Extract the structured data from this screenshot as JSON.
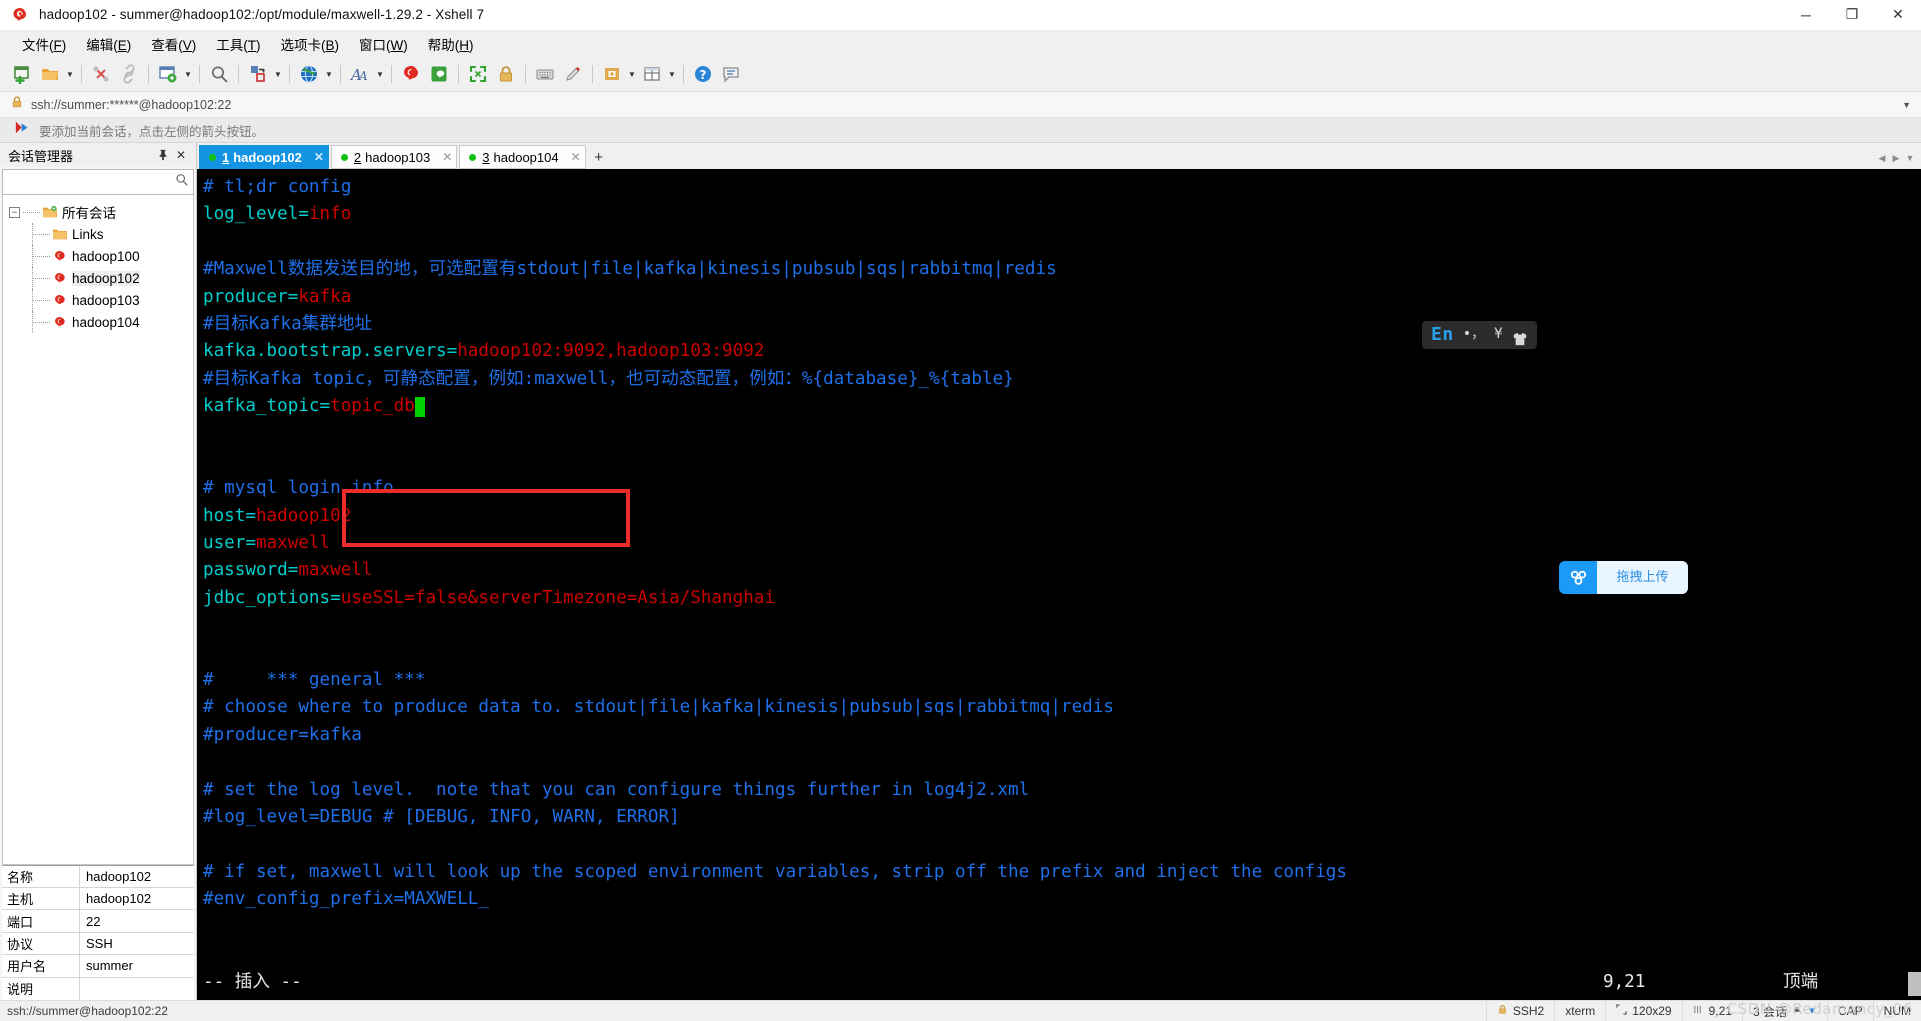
{
  "window": {
    "title": "hadoop102 - summer@hadoop102:/opt/module/maxwell-1.29.2 - Xshell 7",
    "minimize": "─",
    "maximize": "❐",
    "close": "✕"
  },
  "menu": {
    "items": [
      {
        "label": "文件",
        "accel": "F"
      },
      {
        "label": "编辑",
        "accel": "E"
      },
      {
        "label": "查看",
        "accel": "V"
      },
      {
        "label": "工具",
        "accel": "T"
      },
      {
        "label": "选项卡",
        "accel": "B"
      },
      {
        "label": "窗口",
        "accel": "W"
      },
      {
        "label": "帮助",
        "accel": "H"
      }
    ]
  },
  "toolbar": {
    "icons": [
      "new-session-icon",
      "open-folder-icon",
      "connect-icon",
      "disconnect-icon",
      "session-properties-icon",
      "find-icon",
      "transfer-file-icon",
      "web-browser-icon",
      "font-icon",
      "xshell-icon",
      "xftp-icon",
      "fullscreen-icon",
      "lock-icon",
      "keyboard-icon",
      "highlight-icon",
      "add-note-icon",
      "layout-icon",
      "help-icon",
      "feedback-icon"
    ]
  },
  "address": {
    "lock_icon": "lock-icon",
    "url": "ssh://summer:******@hadoop102:22",
    "dropdown_icon": "chevron-down-icon"
  },
  "notice": {
    "icon": "red-arrow-icon",
    "text": "要添加当前会话，点击左侧的箭头按钮。"
  },
  "sidebar": {
    "title": "会话管理器",
    "pin_icon": "pin-icon",
    "close_icon": "close-icon",
    "search": {
      "value": "",
      "placeholder": "",
      "icon": "search-icon"
    },
    "tree": {
      "root": {
        "label": "所有会话",
        "icon": "folder-sessions-icon",
        "expander": "−"
      },
      "children": [
        {
          "label": "Links",
          "icon": "folder-icon",
          "selected": false
        },
        {
          "label": "hadoop100",
          "icon": "xshell-session-icon",
          "selected": false
        },
        {
          "label": "hadoop102",
          "icon": "xshell-session-icon",
          "selected": true
        },
        {
          "label": "hadoop103",
          "icon": "xshell-session-icon",
          "selected": false
        },
        {
          "label": "hadoop104",
          "icon": "xshell-session-icon",
          "selected": false
        }
      ]
    },
    "properties": [
      {
        "key": "名称",
        "value": "hadoop102"
      },
      {
        "key": "主机",
        "value": "hadoop102"
      },
      {
        "key": "端口",
        "value": "22"
      },
      {
        "key": "协议",
        "value": "SSH"
      },
      {
        "key": "用户名",
        "value": "summer"
      },
      {
        "key": "说明",
        "value": ""
      }
    ]
  },
  "tabs": {
    "items": [
      {
        "num": "1",
        "label": "hadoop102",
        "active": true,
        "close": "✕",
        "status": "connected"
      },
      {
        "num": "2",
        "label": "hadoop103",
        "active": false,
        "close": "✕",
        "status": "connected"
      },
      {
        "num": "3",
        "label": "hadoop104",
        "active": false,
        "close": "✕",
        "status": "connected"
      }
    ],
    "add_label": "+",
    "nav_left": "◀",
    "nav_right": "▶",
    "nav_down": "▼"
  },
  "ime": {
    "lang": "En",
    "punct": "•，",
    "currency": "¥",
    "skin_icon": "shirt-icon"
  },
  "upload": {
    "icon": "cloud-upload-icon",
    "label": "拖拽上传"
  },
  "annotation": {
    "type": "red-rectangle-highlight",
    "color": "#ee2b2b"
  },
  "terminal": {
    "colors": {
      "background": "#000000",
      "comment": "#1e6fe8",
      "key": "#00cdcd",
      "value": "#cc0000",
      "text": "#e8e8e8",
      "cursor": "#00d000"
    },
    "lines": [
      {
        "segs": [
          {
            "t": "# tl;dr config",
            "c": "comment"
          }
        ]
      },
      {
        "segs": [
          {
            "t": "log_level",
            "c": "key"
          },
          {
            "t": "=",
            "c": "key"
          },
          {
            "t": "info",
            "c": "value"
          }
        ]
      },
      {
        "segs": []
      },
      {
        "segs": [
          {
            "t": "#Maxwell数据发送目的地，可选配置有stdout|file|kafka|kinesis|pubsub|sqs|rabbitmq|redis",
            "c": "comment"
          }
        ]
      },
      {
        "segs": [
          {
            "t": "producer",
            "c": "key"
          },
          {
            "t": "=",
            "c": "key"
          },
          {
            "t": "kafka",
            "c": "value"
          }
        ]
      },
      {
        "segs": [
          {
            "t": "#目标Kafka集群地址",
            "c": "comment"
          }
        ]
      },
      {
        "segs": [
          {
            "t": "kafka.bootstrap.servers",
            "c": "key"
          },
          {
            "t": "=",
            "c": "key"
          },
          {
            "t": "hadoop102:9092,hadoop103:9092",
            "c": "value"
          }
        ]
      },
      {
        "segs": [
          {
            "t": "#目标Kafka topic，可静态配置，例如:maxwell，也可动态配置，例如：%{database}_%{table}",
            "c": "comment"
          }
        ]
      },
      {
        "segs": [
          {
            "t": "kafka_topic",
            "c": "key"
          },
          {
            "t": "=",
            "c": "key"
          },
          {
            "t": "topic_db",
            "c": "value"
          },
          {
            "t": " ",
            "c": "cursor"
          }
        ]
      },
      {
        "segs": []
      },
      {
        "segs": []
      },
      {
        "segs": [
          {
            "t": "# mysql login info",
            "c": "comment"
          }
        ]
      },
      {
        "segs": [
          {
            "t": "host",
            "c": "key"
          },
          {
            "t": "=",
            "c": "key"
          },
          {
            "t": "hadoop102",
            "c": "value"
          }
        ]
      },
      {
        "segs": [
          {
            "t": "user",
            "c": "key"
          },
          {
            "t": "=",
            "c": "key"
          },
          {
            "t": "maxwell",
            "c": "value"
          }
        ]
      },
      {
        "segs": [
          {
            "t": "password",
            "c": "key"
          },
          {
            "t": "=",
            "c": "key"
          },
          {
            "t": "maxwell",
            "c": "value"
          }
        ]
      },
      {
        "segs": [
          {
            "t": "jdbc_options",
            "c": "key"
          },
          {
            "t": "=",
            "c": "key"
          },
          {
            "t": "useSSL=false&serverTimezone=Asia/Shanghai",
            "c": "value"
          }
        ]
      },
      {
        "segs": []
      },
      {
        "segs": []
      },
      {
        "segs": [
          {
            "t": "#     *** general ***",
            "c": "comment"
          }
        ]
      },
      {
        "segs": [
          {
            "t": "# choose where to produce data to. stdout|file|kafka|kinesis|pubsub|sqs|rabbitmq|redis",
            "c": "comment"
          }
        ]
      },
      {
        "segs": [
          {
            "t": "#producer=kafka",
            "c": "comment"
          }
        ]
      },
      {
        "segs": []
      },
      {
        "segs": [
          {
            "t": "# set the log level.  note that you can configure things further in log4j2.xml",
            "c": "comment"
          }
        ]
      },
      {
        "segs": [
          {
            "t": "#log_level=DEBUG # [DEBUG, INFO, WARN, ERROR]",
            "c": "comment"
          }
        ]
      },
      {
        "segs": []
      },
      {
        "segs": [
          {
            "t": "# if set, maxwell will look up the scoped environment variables, strip off the prefix and inject the configs",
            "c": "comment"
          }
        ]
      },
      {
        "segs": [
          {
            "t": "#env_config_prefix=MAXWELL_",
            "c": "comment"
          }
        ]
      }
    ],
    "status": {
      "mode": "-- 插入 --",
      "position": "9,21",
      "scroll": "顶端"
    }
  },
  "statusbar": {
    "connection": "ssh://summer@hadoop102:22",
    "security": "SSH2",
    "security_icon": "lock-icon",
    "term_type": "xterm",
    "size": "120x29",
    "size_icon": "size-icon",
    "position": "9,21",
    "position_icon": "caret-pos-icon",
    "sessions": "3 会话",
    "traffic_up_icon": "arrow-up-icon",
    "traffic_down_icon": "arrow-down-icon",
    "caps": "CAP",
    "num": "NUM",
    "watermark": "CSDN @Redamancy_06"
  }
}
